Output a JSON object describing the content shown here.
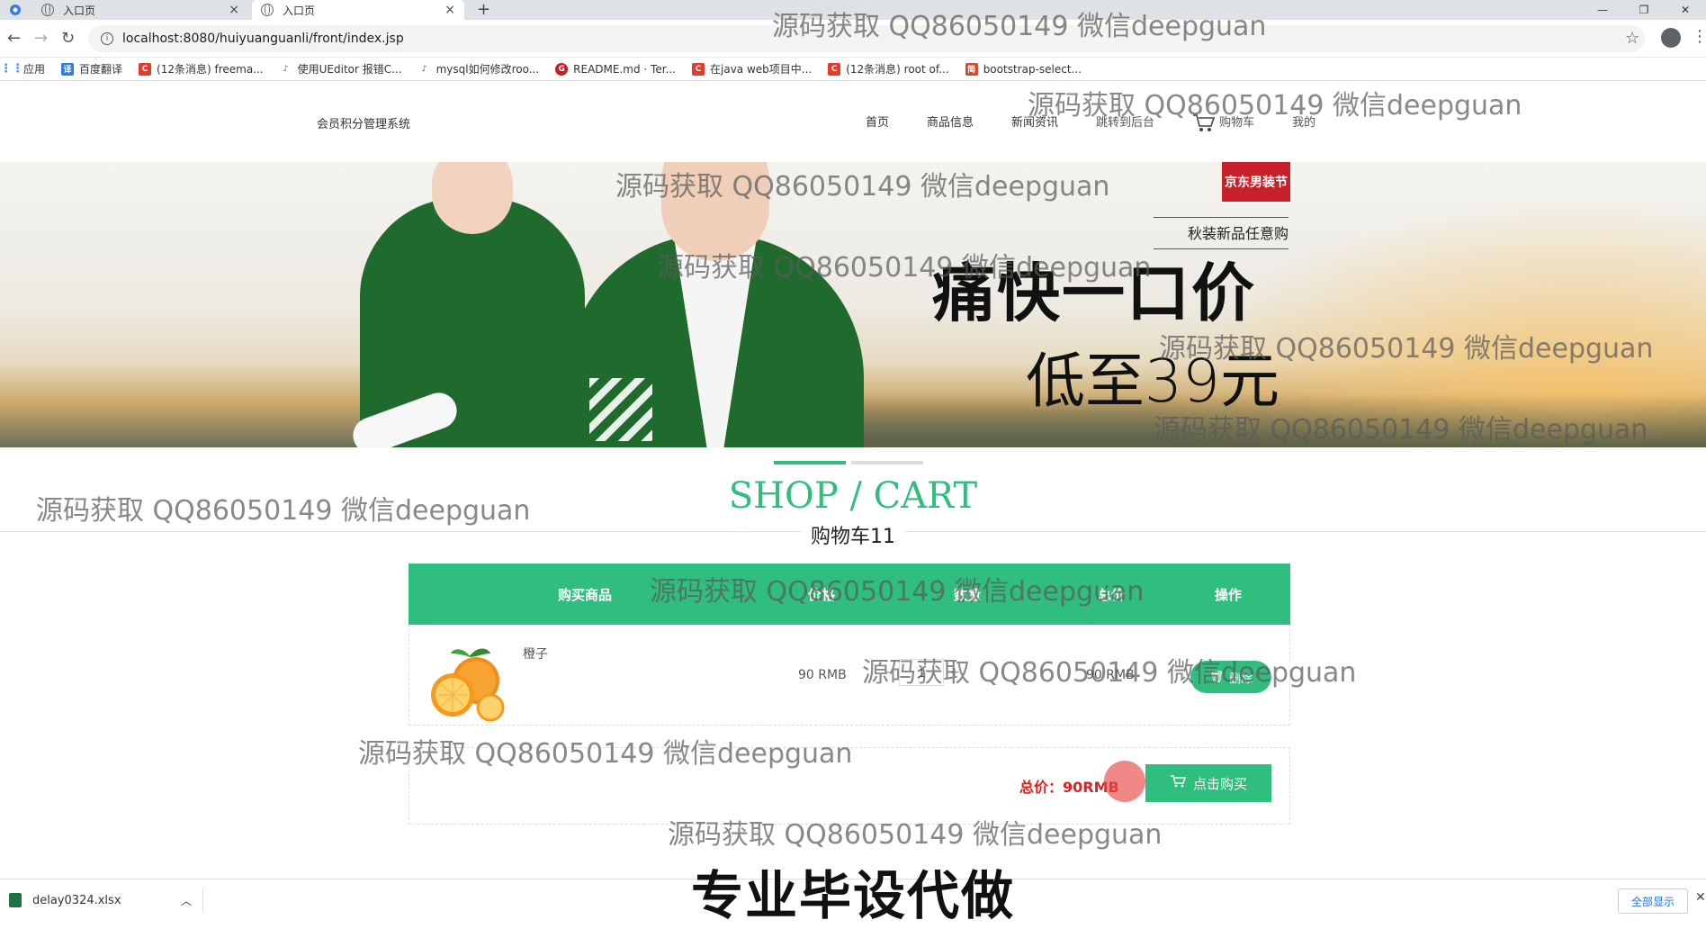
{
  "browser": {
    "tabs": [
      {
        "label": "入口页",
        "close": "×"
      },
      {
        "label": "入口页",
        "close": "×"
      }
    ],
    "new_tab": "+",
    "window_controls": [
      "—",
      "❐",
      "✕"
    ],
    "url": "localhost:8080/huiyuanguanli/front/index.jsp",
    "bookmarks": [
      {
        "label": "应用",
        "color": "#4285f4"
      },
      {
        "label": "百度翻译",
        "color": "#2b7de9"
      },
      {
        "label": "(12条消息) freema...",
        "color": "#e33b2e"
      },
      {
        "label": "使用UEditor 报错C...",
        "color": "#555555"
      },
      {
        "label": "mysql如何修改roo...",
        "color": "#555555"
      },
      {
        "label": "README.md · Ter...",
        "color": "#c71d23"
      },
      {
        "label": "在java web项目中...",
        "color": "#e33b2e"
      },
      {
        "label": "(12条消息) root of...",
        "color": "#e33b2e"
      },
      {
        "label": "bootstrap-select...",
        "color": "#d44b2c"
      }
    ]
  },
  "site": {
    "logo": "会员积分管理系统",
    "nav": [
      {
        "label": "首页"
      },
      {
        "label": "商品信息"
      },
      {
        "label": "新闻资讯"
      },
      {
        "label": "跳转到后台"
      },
      {
        "label": "购物车"
      },
      {
        "label": "我的"
      }
    ]
  },
  "banner": {
    "badge": "京东男装节",
    "subtitle": "秋装新品任意购",
    "headline": "痛快一口价",
    "price": "低至39元"
  },
  "section": {
    "title": "SHOP / CART",
    "subtitle": "购物车11"
  },
  "cart": {
    "headers": [
      "购买商品",
      "价格",
      "数量",
      "总价",
      "操作"
    ],
    "items": [
      {
        "name": "橙子",
        "price": "90 RMB",
        "quantity": "1",
        "minus": "-",
        "plus": "+",
        "total": "90 RMB",
        "action": "删除"
      }
    ],
    "total_label": "总价：90RMB",
    "buy_label": "点击购买"
  },
  "downloads": {
    "file": "delay0324.xlsx",
    "show_all": "全部显示",
    "close": "✕"
  },
  "watermarks": {
    "text": "源码获取 QQ86050149 微信deepguan",
    "big": "专业毕设代做"
  },
  "colors": {
    "accent": "#2fbe7d",
    "total_red": "#e02020"
  }
}
